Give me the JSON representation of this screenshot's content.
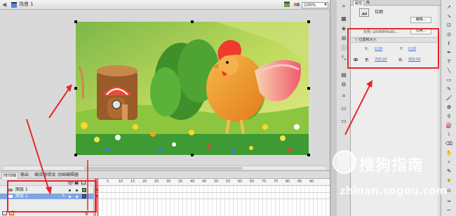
{
  "scene_bar": {
    "scene_label": "场景 1",
    "zoom": "100%"
  },
  "timeline": {
    "tabs": [
      "时间轴",
      "输出",
      "编译器错误",
      "动画编辑器"
    ],
    "layers": [
      {
        "name": "图层 1",
        "selected": false
      },
      {
        "name": "图层 2",
        "selected": true
      }
    ],
    "ruler_numbers": [
      "5",
      "10",
      "15",
      "20",
      "25",
      "30",
      "35",
      "40",
      "45",
      "50",
      "55",
      "60",
      "65",
      "70",
      "75",
      "80",
      "85",
      "90"
    ]
  },
  "properties": {
    "tabs": [
      "属性",
      "库"
    ],
    "object_type": "位图",
    "edit_button": "编辑...",
    "instance_label": "实例: q5068f0fa81...",
    "swap_button": "交换...",
    "section": "位置和大小",
    "x_label": "X:",
    "x_value": "0.00",
    "y_label": "Y:",
    "y_value": "0.00",
    "w_label": "宽:",
    "w_value": "700.00",
    "h_label": "高:",
    "h_value": "400.00"
  },
  "watermark": {
    "text": "搜狗指南",
    "url": "zhinan.sogou.com"
  },
  "colors": {
    "annotation_red": "#e6262e",
    "selection_blue": "#7fa6e4",
    "link_blue": "#3a6fc7"
  }
}
